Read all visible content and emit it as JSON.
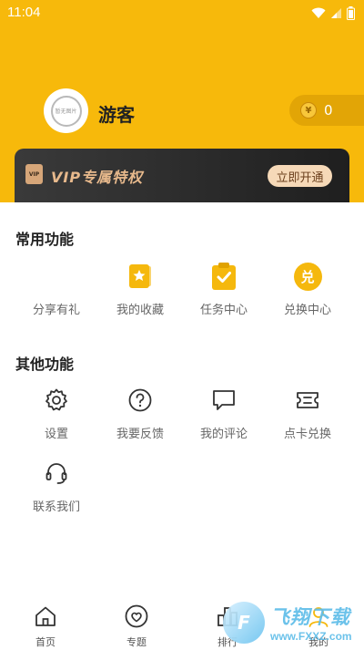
{
  "status": {
    "time": "11:04"
  },
  "profile": {
    "name": "游客",
    "avatar_text": "暂无图片",
    "coins": "0"
  },
  "vip": {
    "badge": "VIP",
    "title": "VIP专属特权",
    "button": "立即开通"
  },
  "common": {
    "title": "常用功能",
    "items": [
      {
        "label": "分享有礼",
        "icon": "gift-icon"
      },
      {
        "label": "我的收藏",
        "icon": "star-icon"
      },
      {
        "label": "任务中心",
        "icon": "clipboard-check-icon"
      },
      {
        "label": "兑换中心",
        "icon": "exchange-icon",
        "glyph": "兑"
      }
    ]
  },
  "other": {
    "title": "其他功能",
    "items": [
      {
        "label": "设置",
        "icon": "gear-icon"
      },
      {
        "label": "我要反馈",
        "icon": "question-icon"
      },
      {
        "label": "我的评论",
        "icon": "comment-icon"
      },
      {
        "label": "点卡兑换",
        "icon": "ticket-icon"
      },
      {
        "label": "联系我们",
        "icon": "headset-icon"
      }
    ]
  },
  "tabbar": {
    "tabs": [
      {
        "label": "首页",
        "icon": "home-icon"
      },
      {
        "label": "专题",
        "icon": "heart-icon"
      },
      {
        "label": "排行",
        "icon": "ranking-icon"
      },
      {
        "label": "我的",
        "icon": "profile-icon"
      }
    ]
  },
  "watermark": {
    "logo_text": "F",
    "text": "飞翔下载",
    "url": "www.FXXZ.com"
  },
  "colors": {
    "brand": "#F7B90B",
    "vip_dark": "#2a2a2a",
    "vip_gold": "#E7B98C",
    "icon_yellow": "#F5B80D"
  }
}
